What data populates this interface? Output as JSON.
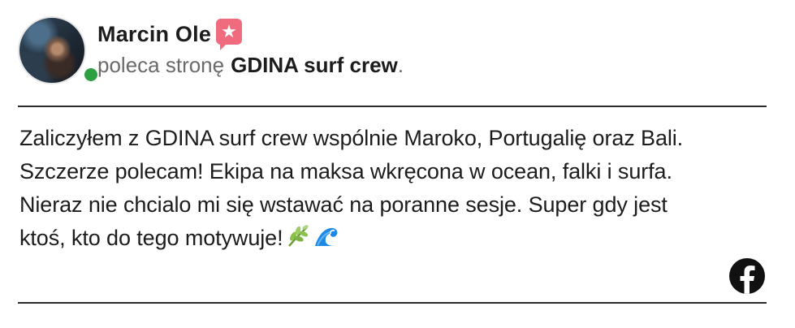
{
  "reviewer": {
    "name": "Marcin Ole",
    "online": true,
    "badge_icon": "recommendation-star-icon"
  },
  "recommendation": {
    "verb": "poleca stronę",
    "page_name": "GDINA surf crew",
    "end_punct": "."
  },
  "review": {
    "lines": [
      "Zaliczyłem z GDINA surf crew wspólnie Maroko, Portugalię oraz Bali.",
      "Szczerze polecam! Ekipa na maksa wkręcona w ocean, falki i surfa.",
      "Nieraz nie chcialo mi się wstawać na poranne sesje. Super gdy jest",
      "ktoś, kto do tego motywuje!"
    ],
    "emojis": [
      "herb-icon",
      "water-wave-icon"
    ]
  },
  "source": {
    "icon": "facebook-icon"
  },
  "colors": {
    "badge": "#ef6b7d",
    "online": "#2ea043",
    "text": "#1c1c1c",
    "muted": "#6a6a6a"
  }
}
